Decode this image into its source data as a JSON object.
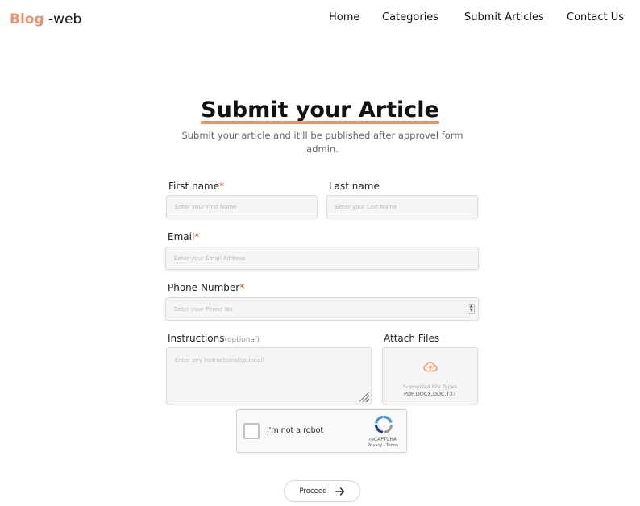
{
  "header": {
    "logo_brand": "Blog",
    "logo_suffix": "-web",
    "nav": [
      "Home",
      "Categories",
      "Submit Articles",
      "Contact Us"
    ]
  },
  "page": {
    "title": "Submit your Article",
    "subtitle": "Submit your article and it'll be published after approvel form admin."
  },
  "form": {
    "first_name": {
      "label": "First name",
      "required_mark": "*",
      "placeholder": "Enter your First Name"
    },
    "last_name": {
      "label": "Last name",
      "placeholder": "Enter your Last Name"
    },
    "email": {
      "label": "Email",
      "required_mark": "*",
      "placeholder": "Enter your Email Address"
    },
    "phone": {
      "label": "Phone Number",
      "required_mark": "*",
      "placeholder": "Enter your Phone No."
    },
    "instructions": {
      "label": "Instructions",
      "optional": "(optional)",
      "placeholder": "Enter any instructions(optional)"
    },
    "attach": {
      "label": "Attach Files",
      "supported": "Supported File Types",
      "types": "PDF,DOCX,DOC,TXT",
      "icon": "cloud-upload-icon"
    }
  },
  "captcha": {
    "text": "I'm not a robot",
    "brand": "reCAPTCHA",
    "links": "Privacy - Terms"
  },
  "actions": {
    "proceed": "Proceed",
    "proceed_icon": "arrow-right-icon"
  },
  "colors": {
    "accent": "#e8956b",
    "required": "#d4362a"
  }
}
